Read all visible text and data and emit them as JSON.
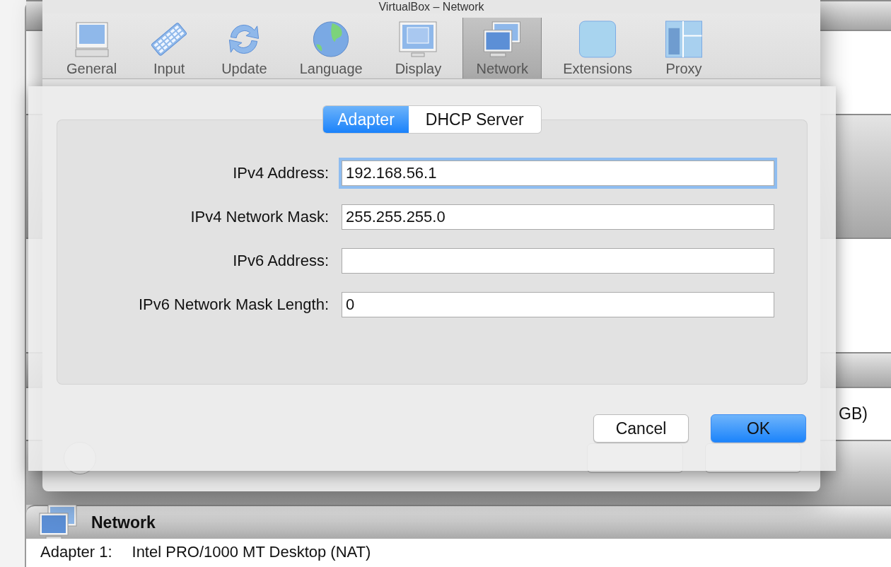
{
  "background_window": {
    "partial_text": "GB)",
    "section_title": "Network",
    "details": [
      {
        "label": "Adapter 1:",
        "value": "Intel PRO/1000 MT Desktop (NAT)"
      }
    ]
  },
  "preferences": {
    "title": "VirtualBox – Network",
    "toolbar": [
      {
        "label": "General",
        "kind": "general",
        "selected": false
      },
      {
        "label": "Input",
        "kind": "input",
        "selected": false
      },
      {
        "label": "Update",
        "kind": "update",
        "selected": false
      },
      {
        "label": "Language",
        "kind": "language",
        "selected": false
      },
      {
        "label": "Display",
        "kind": "display",
        "selected": false
      },
      {
        "label": "Network",
        "kind": "network",
        "selected": true
      },
      {
        "label": "Extensions",
        "kind": "extensions",
        "selected": false
      },
      {
        "label": "Proxy",
        "kind": "proxy",
        "selected": false
      }
    ]
  },
  "sheet": {
    "tabs": [
      {
        "label": "Adapter",
        "selected": true
      },
      {
        "label": "DHCP Server",
        "selected": false
      }
    ],
    "fields": [
      {
        "label": "IPv4 Address:",
        "value": "192.168.56.1",
        "focused": true
      },
      {
        "label": "IPv4 Network Mask:",
        "value": "255.255.255.0",
        "focused": false
      },
      {
        "label": "IPv6 Address:",
        "focused": false
      },
      {
        "label": "IPv6 Network Mask Length:",
        "value": "0",
        "focused": false
      }
    ],
    "buttons": [
      {
        "label": "Cancel",
        "default": false
      },
      {
        "label": "OK",
        "default": true
      }
    ]
  }
}
